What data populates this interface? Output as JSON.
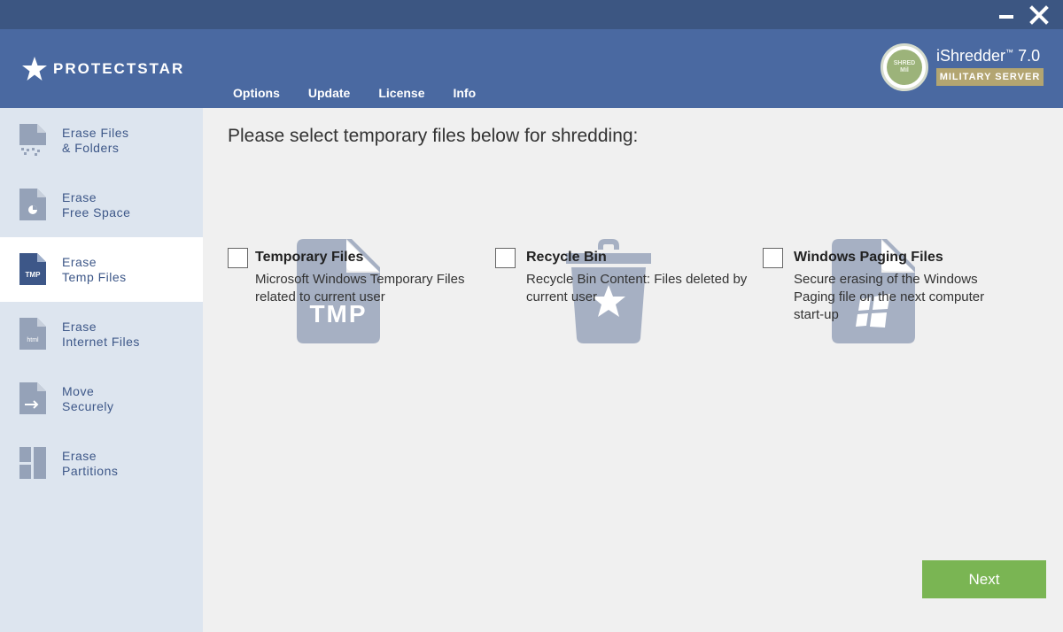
{
  "window": {
    "minimize_icon": "minimize-icon",
    "close_icon": "close-icon"
  },
  "header": {
    "brand": "PROTECTSTAR",
    "product_name": "iShredder",
    "product_tm": "™",
    "product_version": "7.0",
    "edition": "MILITARY SERVER",
    "seal_top": "SHRED",
    "seal_bottom": "Mil",
    "nav": [
      {
        "label": "Options"
      },
      {
        "label": "Update"
      },
      {
        "label": "License"
      },
      {
        "label": "Info"
      }
    ]
  },
  "sidebar": {
    "items": [
      {
        "line1": "Erase Files",
        "line2": "& Folders",
        "icon": "file-shred-icon"
      },
      {
        "line1": "Erase",
        "line2": "Free Space",
        "icon": "pie-file-icon"
      },
      {
        "line1": "Erase",
        "line2": "Temp Files",
        "icon": "tmp-file-icon",
        "active": true,
        "badge": "TMP"
      },
      {
        "line1": "Erase",
        "line2": "Internet Files",
        "icon": "html-file-icon",
        "badge": "html"
      },
      {
        "line1": "Move",
        "line2": "Securely",
        "icon": "move-file-icon"
      },
      {
        "line1": "Erase",
        "line2": "Partitions",
        "icon": "partition-icon"
      }
    ]
  },
  "main": {
    "title": "Please select temporary files below for shredding:",
    "options": [
      {
        "title": "Temporary Files",
        "desc": "Microsoft Windows Temporary Files related to current user",
        "art_label": "TMP",
        "checked": false
      },
      {
        "title": "Recycle Bin",
        "desc": "Recycle Bin Content: Files deleted by current user",
        "checked": false
      },
      {
        "title": "Windows Paging Files",
        "desc": "Secure erasing of the Windows Paging file on the next computer start-up",
        "checked": false
      }
    ],
    "next_label": "Next"
  },
  "colors": {
    "header": "#4a69a1",
    "titlebar": "#3c5682",
    "sidebar": "#dde5ef",
    "accent_text": "#3d5788",
    "art": "#a6b0c3",
    "next": "#7ab553",
    "edition": "#b3a571"
  }
}
